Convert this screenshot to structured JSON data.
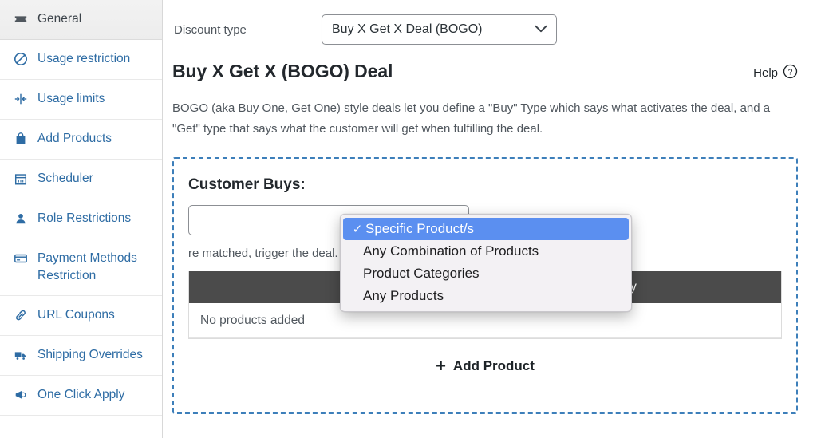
{
  "sidebar": {
    "items": [
      {
        "label": "General",
        "icon": "ticket-icon",
        "active": true
      },
      {
        "label": "Usage restriction",
        "icon": "no-entry-icon",
        "active": false
      },
      {
        "label": "Usage limits",
        "icon": "arrows-collapse-icon",
        "active": false
      },
      {
        "label": "Add Products",
        "icon": "shopping-bag-icon",
        "active": false
      },
      {
        "label": "Scheduler",
        "icon": "calendar-icon",
        "active": false
      },
      {
        "label": "Role Restrictions",
        "icon": "user-icon",
        "active": false
      },
      {
        "label": "Payment Methods Restriction",
        "icon": "credit-card-icon",
        "active": false
      },
      {
        "label": "URL Coupons",
        "icon": "link-icon",
        "active": false
      },
      {
        "label": "Shipping Overrides",
        "icon": "truck-icon",
        "active": false
      },
      {
        "label": "One Click Apply",
        "icon": "megaphone-icon",
        "active": false
      }
    ]
  },
  "topbar": {
    "discount_type_label": "Discount type",
    "discount_type_value": "Buy X Get X Deal (BOGO)"
  },
  "section": {
    "title": "Buy X Get X (BOGO) Deal",
    "help_label": "Help",
    "description": "BOGO (aka Buy One, Get One) style deals let you define a \"Buy\" Type which says what activates the deal, and a \"Get\" type that says what the customer will get when fulfilling the deal."
  },
  "panel": {
    "title": "Customer Buys:",
    "buys_type_value": "Specific Product/s",
    "hint": "re matched, trigger the deal.",
    "table": {
      "headers": {
        "product": "",
        "quantity": "Quantity"
      },
      "empty_text": "No products added"
    },
    "add_product_label": "Add Product",
    "add_product_plus": "+"
  },
  "dropdown": {
    "check_glyph": "✓",
    "options": [
      {
        "label": "Specific Product/s",
        "selected": true
      },
      {
        "label": "Any Combination of Products",
        "selected": false
      },
      {
        "label": "Product Categories",
        "selected": false
      },
      {
        "label": "Any Products",
        "selected": false
      }
    ]
  },
  "colors": {
    "sidebar_link": "#2e6ca4",
    "dashed_border": "#3d7fba",
    "table_header_bg": "#4b4b4b",
    "dropdown_highlight": "#5b8ff0"
  }
}
